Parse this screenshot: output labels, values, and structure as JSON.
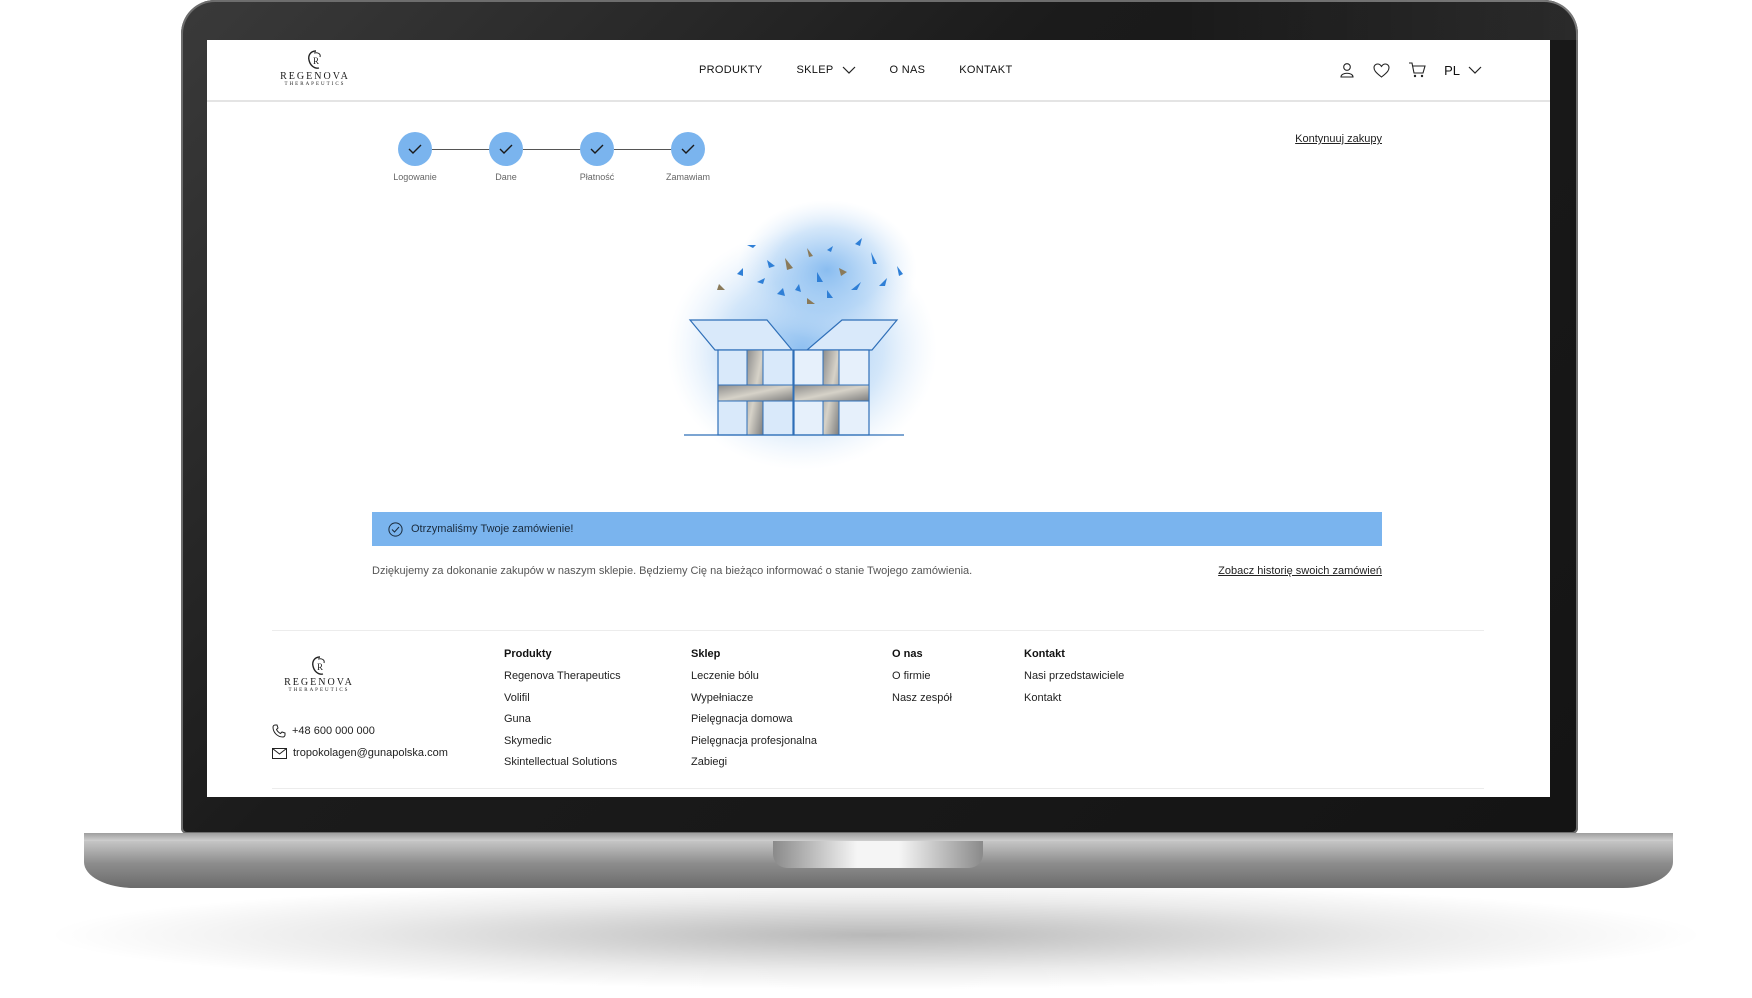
{
  "brand": {
    "name": "REGENOVA",
    "tagline": "THERAPEUTICS",
    "mark": "R"
  },
  "nav": {
    "items": [
      "PRODUKTY",
      "SKLEP",
      "O NAS",
      "KONTAKT"
    ],
    "language": "PL"
  },
  "header_icons": [
    "user-icon",
    "heart-icon",
    "cart-icon"
  ],
  "steps": [
    {
      "label": "Logowanie",
      "done": true
    },
    {
      "label": "Dane",
      "done": true
    },
    {
      "label": "Płatność",
      "done": true
    },
    {
      "label": "Zamawiam",
      "done": true
    }
  ],
  "continue_link": "Kontynuuj zakupy",
  "banner": {
    "text": "Otrzymaliśmy Twoje zamówienie!"
  },
  "thanks_text": "Dziękujemy za dokonanie zakupów w naszym sklepie. Będziemy Cię na bieżąco informować o stanie Twojego zamówienia.",
  "history_link": "Zobacz historię swoich zamówień",
  "footer": {
    "phone": "+48 600 000 000",
    "email": "tropokolagen@gunapolska.com",
    "columns": [
      {
        "heading": "Produkty",
        "items": [
          "Regenova Therapeutics",
          "Volifil",
          "Guna",
          "Skymedic",
          "Skintellectual Solutions"
        ]
      },
      {
        "heading": "Sklep",
        "items": [
          "Leczenie bólu",
          "Wypełniacze",
          "Pielęgnacja domowa",
          "Pielęgnacja profesjonalna",
          "Zabiegi"
        ]
      },
      {
        "heading": "O nas",
        "items": [
          "O firmie",
          "Nasz zespół"
        ]
      },
      {
        "heading": "Kontakt",
        "items": [
          "Nasi przedstawiciele",
          "Kontakt"
        ]
      }
    ]
  },
  "colors": {
    "accent": "#7ab4ee",
    "text": "#222222"
  }
}
